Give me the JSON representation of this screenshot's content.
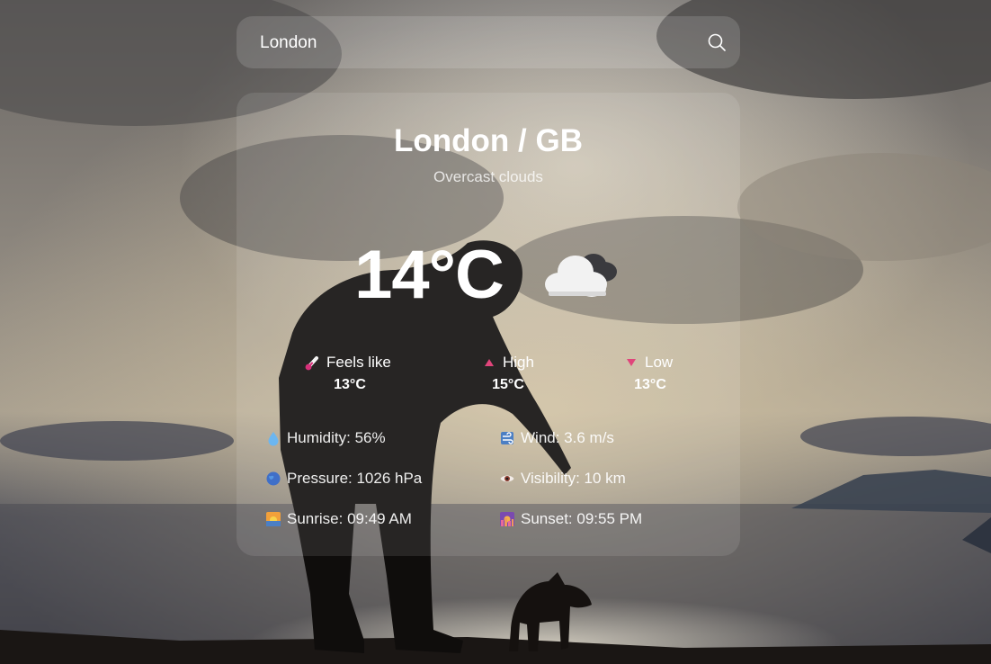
{
  "search": {
    "value": "London",
    "icon": "search-icon"
  },
  "weather": {
    "city": "London / GB",
    "description": "Overcast clouds",
    "temperature": "14°C",
    "condition_icon": "cloudy-icon",
    "feels_like": {
      "label": "Feels like",
      "value": "13°C",
      "icon": "thermometer-icon"
    },
    "high": {
      "label": "High",
      "value": "15°C",
      "icon": "triangle-up-icon"
    },
    "low": {
      "label": "Low",
      "value": "13°C",
      "icon": "triangle-down-icon"
    },
    "details": {
      "humidity": {
        "text": "Humidity: 56%",
        "icon": "droplet-icon"
      },
      "wind": {
        "text": "Wind: 3.6 m/s",
        "icon": "wind-icon"
      },
      "pressure": {
        "text": "Pressure: 1026 hPa",
        "icon": "globe-icon"
      },
      "visibility": {
        "text": "Visibility: 10 km",
        "icon": "eye-icon"
      },
      "sunrise": {
        "text": "Sunrise: 09:49 AM",
        "icon": "sunrise-icon"
      },
      "sunset": {
        "text": "Sunset: 09:55 PM",
        "icon": "sunset-icon"
      }
    }
  },
  "colors": {
    "high_marker": "#e0457b",
    "low_marker": "#e0457b",
    "card_glass": "rgba(255,255,255,0.10)"
  }
}
